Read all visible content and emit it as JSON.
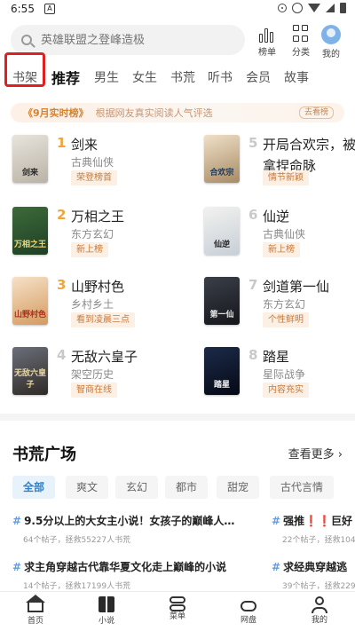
{
  "status": {
    "time": "6:55",
    "notif": "A"
  },
  "header": {
    "search_placeholder": "英雄联盟之登峰造极",
    "rank_label": "榜单",
    "category_label": "分类",
    "me_label": "我的"
  },
  "tabs": [
    {
      "label": "书架"
    },
    {
      "label": "推荐"
    },
    {
      "label": "男生"
    },
    {
      "label": "女生"
    },
    {
      "label": "书荒"
    },
    {
      "label": "听书"
    },
    {
      "label": "会员"
    },
    {
      "label": "故事"
    }
  ],
  "banner": {
    "tag": "《9月实时榜》",
    "subtitle": "根据网友真实阅读人气评选",
    "badge": "去看榜"
  },
  "books": [
    {
      "rank": "1",
      "title": "剑来",
      "genre": "古典仙侠",
      "tag": "荣登榜首",
      "cover_text": "剑来",
      "rank_color": "#f0a53c"
    },
    {
      "rank": "2",
      "title": "万相之王",
      "genre": "东方玄幻",
      "tag": "新上榜",
      "cover_text": "万相之王",
      "rank_color": "#f0a53c"
    },
    {
      "rank": "3",
      "title": "山野村色",
      "genre": "乡村乡土",
      "tag": "看到凌晨三点",
      "cover_text": "山野村色",
      "rank_color": "#f0a53c"
    },
    {
      "rank": "4",
      "title": "无敌六皇子",
      "genre": "架空历史",
      "tag": "智商在线",
      "cover_text": "无敌六皇子",
      "rank_color": "#c9c9c9"
    },
    {
      "rank": "5",
      "title": "开局合欢宗，被",
      "title2": "拿捏命脉",
      "genre": "",
      "tag": "情节新颖",
      "cover_text": "合欢宗",
      "rank_color": "#c9c9c9"
    },
    {
      "rank": "6",
      "title": "仙逆",
      "genre": "古典仙侠",
      "tag": "新上榜",
      "cover_text": "仙逆",
      "rank_color": "#c9c9c9"
    },
    {
      "rank": "7",
      "title": "剑道第一仙",
      "genre": "东方玄幻",
      "tag": "个性鲜明",
      "cover_text": "第一仙",
      "rank_color": "#c9c9c9"
    },
    {
      "rank": "8",
      "title": "踏星",
      "genre": "星际战争",
      "tag": "内容充实",
      "cover_text": "踏星",
      "rank_color": "#c9c9c9"
    }
  ],
  "section": {
    "title": "书荒广场",
    "more": "查看更多 ›"
  },
  "chips": [
    "全部",
    "爽文",
    "玄幻",
    "都市",
    "甜宠",
    "古代言情"
  ],
  "topics": [
    {
      "title": "9.5分以上的大女主小说！女孩子的巅峰人…",
      "meta": "64个帖子，拯救55227人书荒"
    },
    {
      "title": "强推❗❗巨好",
      "meta": "22个帖子，拯救104"
    },
    {
      "title": "求主角穿越古代靠华夏文化走上巅峰的小说",
      "meta": "14个帖子，拯救17199人书荒"
    },
    {
      "title": "求经典穿越逃",
      "meta": "39个帖子，拯救229"
    }
  ],
  "bottom_nav": [
    {
      "label": "首页"
    },
    {
      "label": "小说"
    },
    {
      "label": "菜单"
    },
    {
      "label": "网盘"
    },
    {
      "label": "我的"
    }
  ]
}
